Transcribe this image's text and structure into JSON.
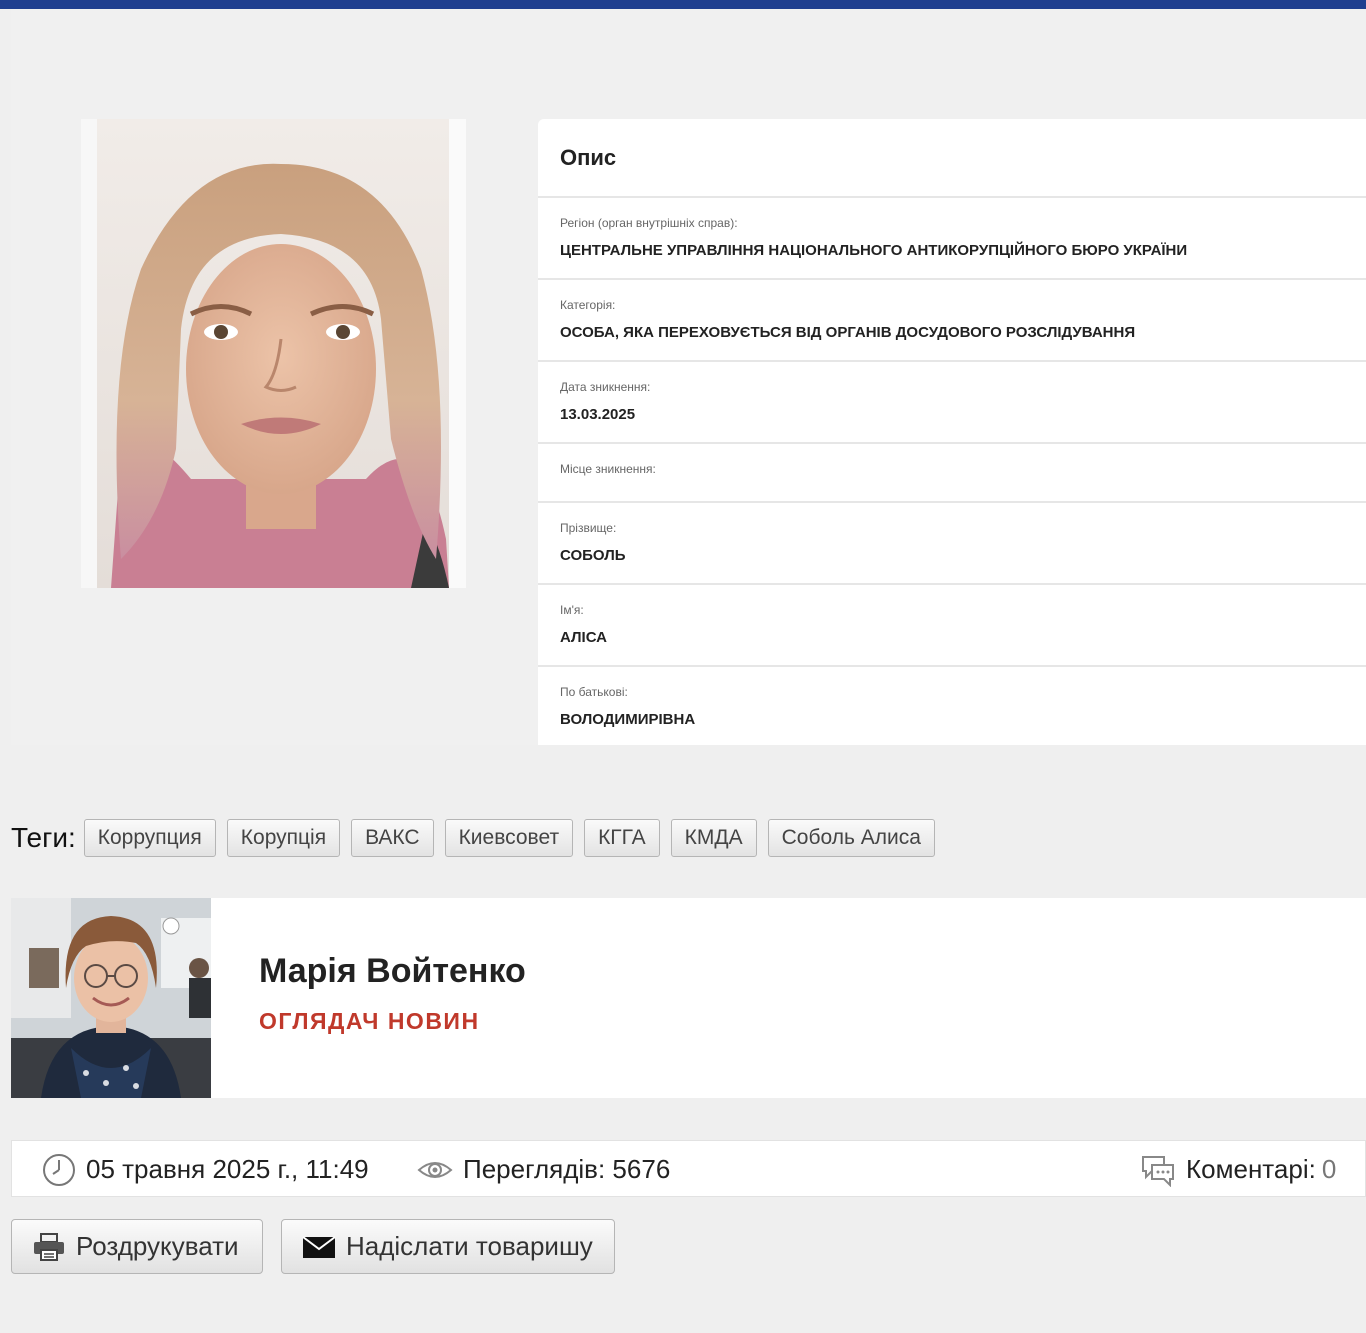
{
  "description": {
    "title": "Опис",
    "fields": [
      {
        "label": "Регіон (орган внутрішніх справ):",
        "value": "ЦЕНТРАЛЬНЕ УПРАВЛІННЯ НАЦІОНАЛЬНОГО АНТИКОРУПЦІЙНОГО БЮРО УКРАЇНИ"
      },
      {
        "label": "Категорія:",
        "value": "ОСОБА, ЯКА ПЕРЕХОВУЄТЬСЯ ВІД ОРГАНІВ ДОСУДОВОГО РОЗСЛІДУВАННЯ"
      },
      {
        "label": "Дата зникнення:",
        "value": "13.03.2025"
      },
      {
        "label": "Місце зникнення:",
        "value": ""
      },
      {
        "label": "Прізвище:",
        "value": "СОБОЛЬ"
      },
      {
        "label": "Ім'я:",
        "value": "АЛІСА"
      },
      {
        "label": "По батькові:",
        "value": "ВОЛОДИМИРІВНА"
      }
    ]
  },
  "tags": {
    "label": "Теги:",
    "items": [
      "Коррупция",
      "Корупція",
      "ВАКС",
      "Киевсовет",
      "КГГА",
      "КМДА",
      "Соболь Алиса"
    ]
  },
  "author": {
    "name": "Марія Войтенко",
    "role": "ОГЛЯДАЧ НОВИН"
  },
  "meta": {
    "date": "05 травня 2025 г., 11:49",
    "views": "Переглядів: 5676",
    "comments_label": "Коментарі:",
    "comments_count": "0"
  },
  "actions": {
    "print_label": "Роздрукувати",
    "send_label": "Надіслати товаришу"
  },
  "colors": {
    "topbar": "#1f3f8f",
    "author_role": "#c0392b"
  },
  "icons": [
    "clock-icon",
    "eye-icon",
    "comments-icon",
    "printer-icon",
    "envelope-icon"
  ]
}
